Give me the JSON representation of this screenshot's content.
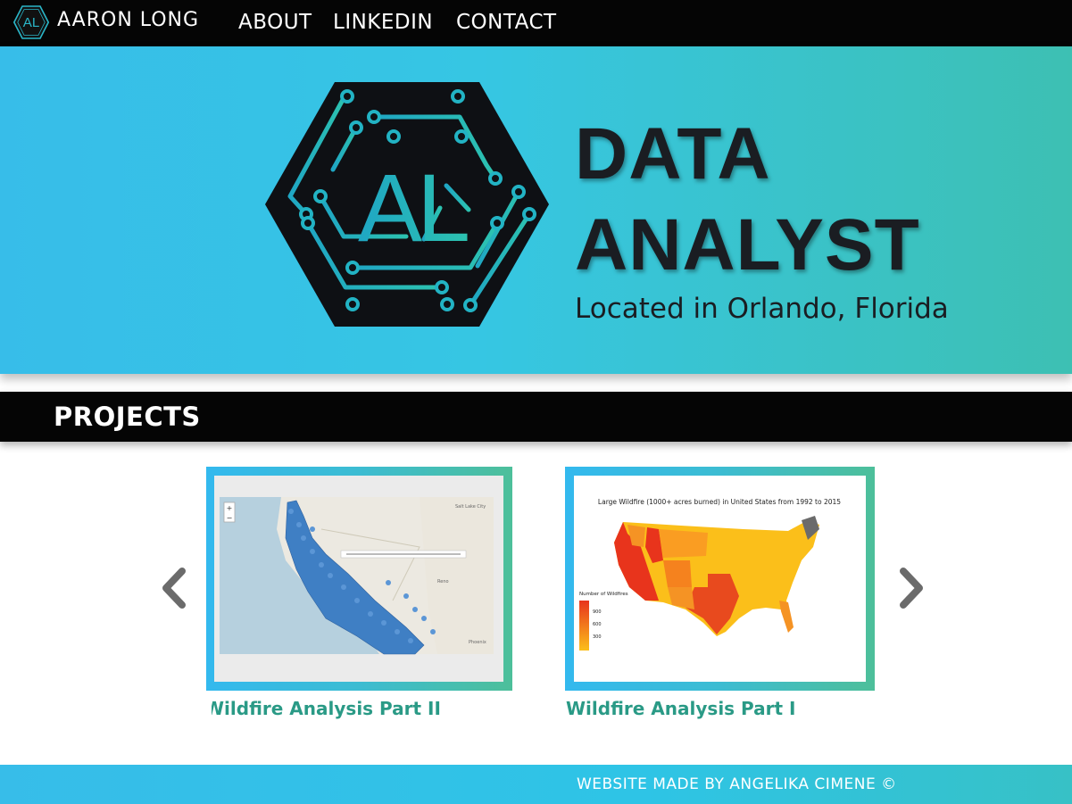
{
  "nav": {
    "name": "AARON LONG",
    "links": [
      {
        "label": "ABOUT"
      },
      {
        "label": "LINKEDIN"
      },
      {
        "label": "CONTACT"
      }
    ]
  },
  "hero": {
    "title_line1": "DATA",
    "title_line2": "ANALYST",
    "subtitle": "Located in Orlando, Florida",
    "logo_text": "AL"
  },
  "projects": {
    "heading": "PROJECTS",
    "cards": [
      {
        "label": "Wildfire Analysis Part II",
        "image": "map-of-california-wildfire-markers"
      },
      {
        "label": "Wildfire Analysis Part I",
        "image": "us-choropleth-wildfire-map",
        "chart_title": "Large Wildfire (1000+ acres burned) in United States from 1992 to 2015",
        "legend_title": "Number of Wildfires",
        "legend_values": [
          "900",
          "600",
          "300"
        ]
      }
    ],
    "map_labels": [
      "Salt Lake City",
      "Phoenix",
      "Reno"
    ]
  },
  "footer": {
    "text": "WEBSITE MADE BY ANGELIKA CIMENE ©"
  },
  "colors": {
    "accent_teal": "#3dc0b3",
    "accent_blue": "#37bde9",
    "label_green": "#2a9a86",
    "nav_bg": "#050505"
  }
}
